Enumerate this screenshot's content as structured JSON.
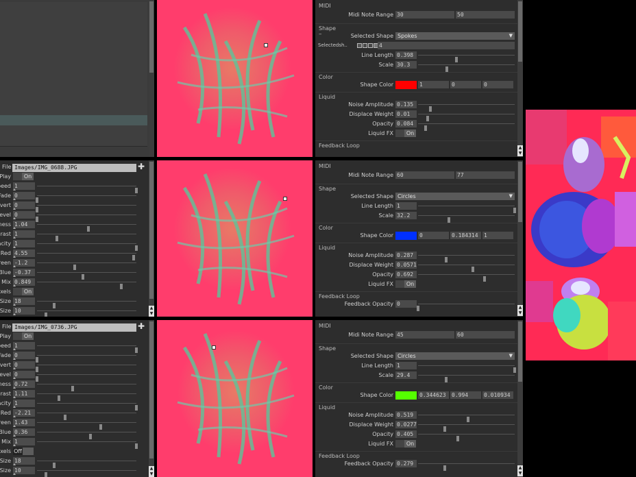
{
  "left_top_list": {
    "rows": 14
  },
  "layers": [
    {
      "file": "Images/IMG_0688.JPG",
      "params": [
        {
          "label": "Play",
          "type": "toggle",
          "value": "On"
        },
        {
          "label": "peed",
          "value": "1",
          "pos": 1.0
        },
        {
          "label": "Fade",
          "value": "0",
          "pos": 0.0
        },
        {
          "label": "vert",
          "value": "0",
          "pos": 0.0
        },
        {
          "label": "evel",
          "value": "0",
          "pos": 0.0
        },
        {
          "label": "hness",
          "value": "1.04",
          "pos": 0.52
        },
        {
          "label": "rast",
          "value": "1",
          "pos": 0.2
        },
        {
          "label": "pacity",
          "value": "1",
          "pos": 1.0
        },
        {
          "label": "Red",
          "value": "4.55",
          "pos": 0.97
        },
        {
          "label": "reen",
          "value": "-1.2",
          "pos": 0.38
        },
        {
          "label": "Blue",
          "value": "-0.37",
          "pos": 0.46
        },
        {
          "label": "Mix",
          "value": "0.849",
          "pos": 0.85
        },
        {
          "label": "ixels",
          "type": "toggle",
          "value": "On"
        },
        {
          "label": "Size",
          "value": "18",
          "pos": 0.17
        },
        {
          "label": "Size",
          "value": "10",
          "pos": 0.09
        }
      ]
    },
    {
      "file": "Images/IMG_0736.JPG",
      "params": [
        {
          "label": "Play",
          "type": "toggle",
          "value": "On"
        },
        {
          "label": "peed",
          "value": "1",
          "pos": 1.0
        },
        {
          "label": "Fade",
          "value": "0",
          "pos": 0.0
        },
        {
          "label": "vert",
          "value": "0",
          "pos": 0.0
        },
        {
          "label": "evel",
          "value": "0",
          "pos": 0.0
        },
        {
          "label": "hness",
          "value": "0.72",
          "pos": 0.36
        },
        {
          "label": "rast",
          "value": "1.11",
          "pos": 0.22
        },
        {
          "label": "pacity",
          "value": "1",
          "pos": 1.0
        },
        {
          "label": "Red",
          "value": "-2.21",
          "pos": 0.28
        },
        {
          "label": "reen",
          "value": "1.43",
          "pos": 0.64
        },
        {
          "label": "Blue",
          "value": "0.36",
          "pos": 0.54
        },
        {
          "label": "Mix",
          "value": "1",
          "pos": 1.0
        },
        {
          "label": "ixels",
          "type": "toggle",
          "value": "Off"
        },
        {
          "label": "Size",
          "value": "18",
          "pos": 0.17
        },
        {
          "label": "Size",
          "value": "10",
          "pos": 0.09
        }
      ]
    }
  ],
  "toggle_on_label": "On",
  "toggle_off_label": "Off",
  "shape_panels": [
    {
      "midi_section": "MIDI",
      "midi_label": "Midi Note Range",
      "midi_low": "30",
      "midi_high": "50",
      "shape_section": "Shape",
      "selected_shape_label": "Selected Shape",
      "selected_shape": "Spokes",
      "selected_dsh_label": "Selectedsh..",
      "selected_dsh_value": "4",
      "line_length_label": "Line Length",
      "line_length": "0.398",
      "line_length_pos": 0.4,
      "scale_label": "Scale",
      "scale": "30.3",
      "scale_pos": 0.3,
      "color_section": "Color",
      "shape_color_label": "Shape Color",
      "shape_color_hex": "#ff0000",
      "shape_color": [
        "1",
        "0",
        "0"
      ],
      "liquid_section": "Liquid",
      "noise_label": "Noise Amplitude",
      "noise": "0.135",
      "noise_pos": 0.13,
      "disp_label": "Displace Weight",
      "disp": "0.01",
      "disp_pos": 0.1,
      "opacity_label": "Opacity",
      "opacity": "0.084",
      "opacity_pos": 0.08,
      "liquidfx_label": "Liquid FX",
      "liquidfx": "On",
      "feedback_section": "Feedback Loop"
    },
    {
      "midi_section": "MIDI",
      "midi_label": "Midi Note Range",
      "midi_low": "60",
      "midi_high": "77",
      "shape_section": "Shape",
      "selected_shape_label": "Selected Shape",
      "selected_shape": "Circles",
      "line_length_label": "Line Length",
      "line_length": "1",
      "line_length_pos": 1.0,
      "scale_label": "Scale",
      "scale": "32.2",
      "scale_pos": 0.32,
      "color_section": "Color",
      "shape_color_label": "Shape Color",
      "shape_color_hex": "#0030ff",
      "shape_color": [
        "0",
        "0.184314",
        "1"
      ],
      "liquid_section": "Liquid",
      "noise_label": "Noise Amplitude",
      "noise": "0.287",
      "noise_pos": 0.29,
      "disp_label": "Displace Weight",
      "disp": "0.0571",
      "disp_pos": 0.57,
      "opacity_label": "Opacity",
      "opacity": "0.692",
      "opacity_pos": 0.69,
      "liquidfx_label": "Liquid FX",
      "liquidfx": "On",
      "feedback_section": "Feedback Loop",
      "feedback_opacity_label": "Feedback Opacity",
      "feedback_opacity": "0",
      "feedback_opacity_pos": 0.0
    },
    {
      "midi_section": "MIDI",
      "midi_label": "Midi Note Range",
      "midi_low": "45",
      "midi_high": "60",
      "shape_section": "Shape",
      "selected_shape_label": "Selected Shape",
      "selected_shape": "Circles",
      "line_length_label": "Line Length",
      "line_length": "1",
      "line_length_pos": 1.0,
      "scale_label": "Scale",
      "scale": "29.4",
      "scale_pos": 0.29,
      "color_section": "Color",
      "shape_color_label": "Shape Color",
      "shape_color_hex": "#55ff00",
      "shape_color": [
        "0.344623",
        "0.994",
        "0.010934"
      ],
      "liquid_section": "Liquid",
      "noise_label": "Noise Amplitude",
      "noise": "0.519",
      "noise_pos": 0.52,
      "disp_label": "Displace Weight",
      "disp": "0.0277",
      "disp_pos": 0.28,
      "opacity_label": "Opacity",
      "opacity": "0.405",
      "opacity_pos": 0.41,
      "liquidfx_label": "Liquid FX",
      "liquidfx": "On",
      "feedback_section": "Feedback Loop",
      "feedback_opacity_label": "Feedback Opacity",
      "feedback_opacity": "0.279",
      "feedback_opacity_pos": 0.28
    }
  ],
  "colors": {
    "preview_bg": "#ff3d6c",
    "panel_bg": "#2d2d2d",
    "field_bg": "#4a4a4a"
  }
}
